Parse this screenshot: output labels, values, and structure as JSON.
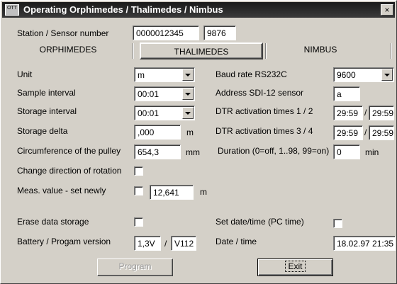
{
  "window": {
    "title": "Operating  Orphimedes / Thalimedes / Nimbus",
    "app_icon_text": "OTT",
    "close_glyph": "×"
  },
  "station": {
    "label": "Station / Sensor number",
    "number": "0000012345",
    "sensor": "9876"
  },
  "tabs": [
    {
      "label": "ORPHIMEDES",
      "active": false
    },
    {
      "label": "THALIMEDES",
      "active": true
    },
    {
      "label": "NIMBUS",
      "active": false
    }
  ],
  "left": {
    "unit": {
      "label": "Unit",
      "value": "m"
    },
    "sample_interval": {
      "label": "Sample interval",
      "value": "00:01"
    },
    "storage_interval": {
      "label": "Storage interval",
      "value": "00:01"
    },
    "storage_delta": {
      "label": "Storage delta",
      "value": ",000",
      "unit": "m"
    },
    "circumference": {
      "label": "Circumference of the pulley",
      "value": "654,3",
      "unit": "mm"
    },
    "change_direction": {
      "label": "Change direction of rotation",
      "checked": false
    },
    "meas_value": {
      "label": "Meas. value - set newly",
      "checked": false,
      "value": "12,641",
      "unit": "m"
    },
    "erase_storage": {
      "label": "Erase data storage",
      "checked": false
    },
    "battery_version": {
      "label": "Battery /  Progam version",
      "battery": "1,3V",
      "separator": "/",
      "version": "V112"
    }
  },
  "right": {
    "baud_rate": {
      "label": "Baud rate RS232C",
      "value": "9600"
    },
    "sdi_address": {
      "label": "Address SDI-12 sensor",
      "value": "a"
    },
    "dtr_12": {
      "label": "DTR activation times 1 / 2",
      "time1": "29:59",
      "separator": "/",
      "time2": "29:59"
    },
    "dtr_34": {
      "label": "DTR activation times 3 / 4",
      "time1": "29:59",
      "separator": "/",
      "time2": "29:59"
    },
    "duration": {
      "label": "Duration (0=off, 1..98, 99=on)",
      "value": "0",
      "unit": "min"
    },
    "set_datetime": {
      "label": "Set date/time (PC time)",
      "checked": false
    },
    "datetime": {
      "label": "Date / time",
      "value": "18.02.97  21:35"
    }
  },
  "buttons": {
    "program": {
      "label": "Program",
      "enabled": false
    },
    "exit": {
      "label": "Exit",
      "enabled": true
    }
  }
}
